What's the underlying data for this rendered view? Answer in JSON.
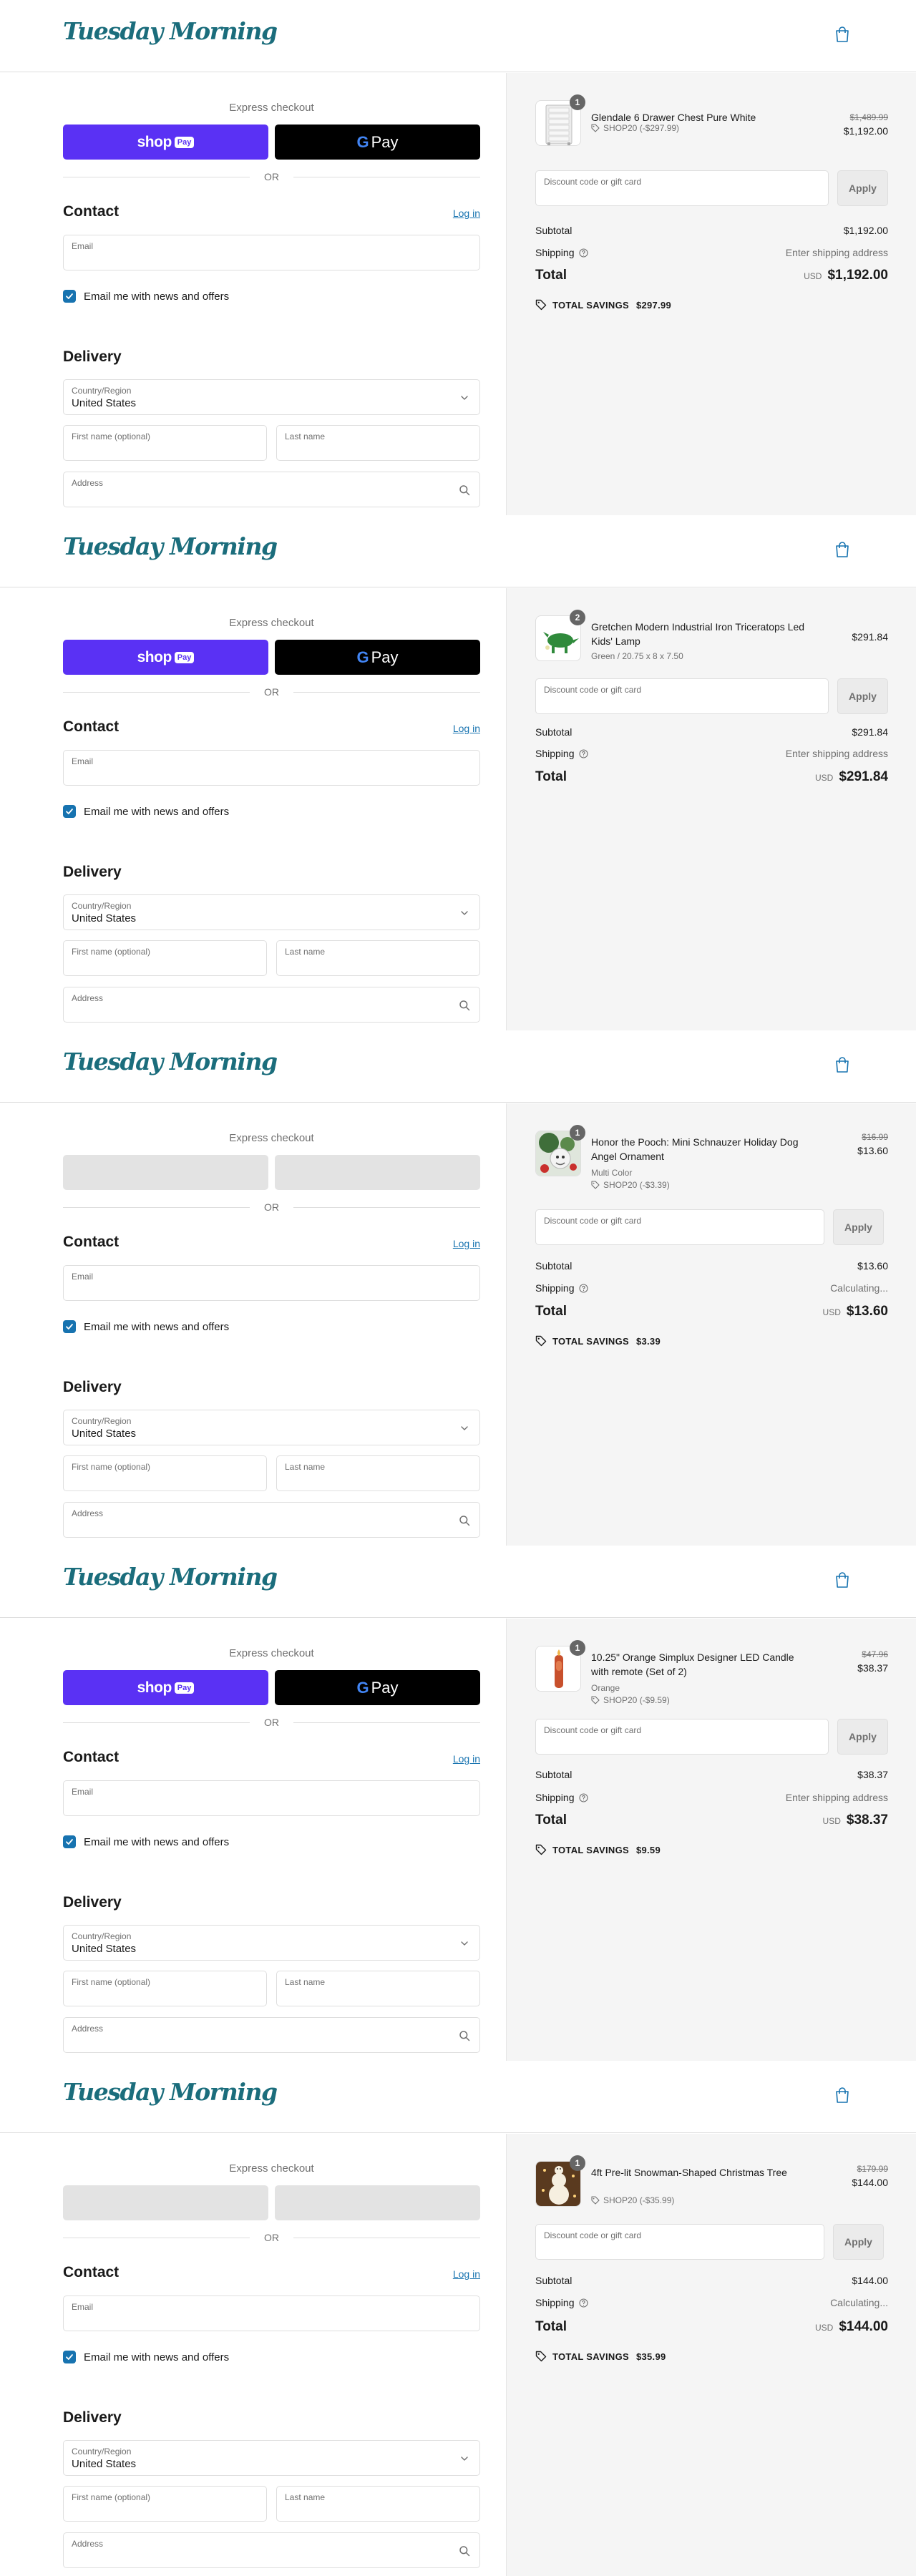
{
  "brand": {
    "logo_text": "Tuesday Morning",
    "accent_color": "#1b6d7c",
    "link_color": "#1773b0",
    "shop_pay_color": "#5a31f4"
  },
  "checkout": {
    "express_label": "Express checkout",
    "shop_pay_label": "shop",
    "shop_pay_pill": "Pay",
    "gpay_g": "G",
    "gpay_label": "Pay",
    "or_label": "OR",
    "contact_heading": "Contact",
    "login_label": "Log in",
    "email_label": "Email",
    "news_label": "Email me with news and offers",
    "delivery_heading": "Delivery",
    "country_label": "Country/Region",
    "country_value": "United States",
    "first_name_label": "First name (optional)",
    "last_name_label": "Last name",
    "address_label": "Address",
    "discount_placeholder": "Discount code or gift card",
    "apply_label": "Apply",
    "subtotal_label": "Subtotal",
    "shipping_label": "Shipping",
    "total_label": "Total",
    "currency": "USD",
    "savings_label": "TOTAL SAVINGS"
  },
  "orders": [
    {
      "express_loading": false,
      "product": {
        "name": "Glendale 6 Drawer Chest Pure White",
        "quantity": "1",
        "variant": "",
        "discount": "SHOP20 (-$297.99)",
        "price_original": "$1,489.99",
        "price": "$1,192.00",
        "image_icon": "white-drawer-chest"
      },
      "subtotal": "$1,192.00",
      "shipping": "Enter shipping address",
      "total": "$1,192.00",
      "savings": "$297.99"
    },
    {
      "express_loading": false,
      "product": {
        "name": "Gretchen Modern Industrial Iron Triceratops Led Kids' Lamp",
        "quantity": "2",
        "variant": "Green / 20.75 x 8 x 7.50",
        "discount": "",
        "price_original": "",
        "price": "$291.84",
        "image_icon": "green-triceratops-lamp"
      },
      "subtotal": "$291.84",
      "shipping": "Enter shipping address",
      "total": "$291.84",
      "savings": ""
    },
    {
      "express_loading": true,
      "product": {
        "name": "Honor the Pooch: Mini Schnauzer Holiday Dog Angel Ornament",
        "quantity": "1",
        "variant": "Multi Color",
        "discount": "SHOP20 (-$3.39)",
        "price_original": "$16.99",
        "price": "$13.60",
        "image_icon": "schnauzer-ornament"
      },
      "subtotal": "$13.60",
      "shipping": "Calculating...",
      "total": "$13.60",
      "savings": "$3.39"
    },
    {
      "express_loading": false,
      "product": {
        "name": "10.25\" Orange Simplux Designer LED Candle with remote (Set of 2)",
        "quantity": "1",
        "variant": "Orange",
        "discount": "SHOP20 (-$9.59)",
        "price_original": "$47.96",
        "price": "$38.37",
        "image_icon": "orange-led-candle"
      },
      "subtotal": "$38.37",
      "shipping": "Enter shipping address",
      "total": "$38.37",
      "savings": "$9.59"
    },
    {
      "express_loading": true,
      "product": {
        "name": "4ft Pre-lit Snowman-Shaped Christmas Tree",
        "quantity": "1",
        "variant": "",
        "discount": "SHOP20 (-$35.99)",
        "price_original": "$179.99",
        "price": "$144.00",
        "image_icon": "snowman-christmas-tree"
      },
      "subtotal": "$144.00",
      "shipping": "Calculating...",
      "total": "$144.00",
      "savings": "$35.99"
    }
  ]
}
